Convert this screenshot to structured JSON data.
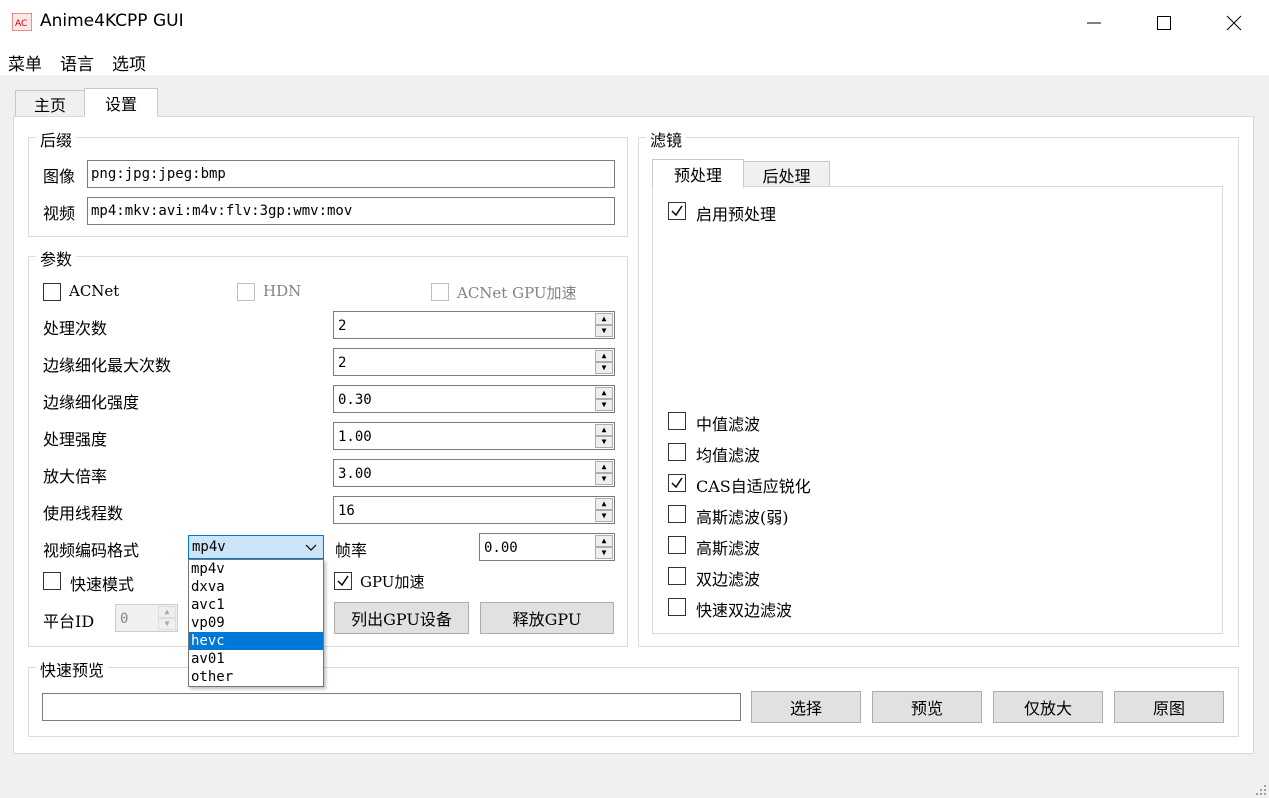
{
  "window": {
    "title": "Anime4KCPP GUI",
    "icon_label": "AC"
  },
  "menu": [
    "菜单",
    "语言",
    "选项"
  ],
  "tabs": [
    {
      "label": "主页"
    },
    {
      "label": "设置"
    }
  ],
  "suffix": {
    "title": "后缀",
    "image_label": "图像",
    "image_value": "png:jpg:jpeg:bmp",
    "video_label": "视频",
    "video_value": "mp4:mkv:avi:m4v:flv:3gp:wmv:mov"
  },
  "params": {
    "title": "参数",
    "acnet": {
      "label": "ACNet",
      "checked": false
    },
    "hdn": {
      "label": "HDN",
      "checked": false
    },
    "acnet_gpu": {
      "label": "ACNet GPU加速",
      "checked": false
    },
    "passes": {
      "label": "处理次数",
      "value": "2"
    },
    "push_grad_passes": {
      "label": "边缘细化最大次数",
      "value": "2"
    },
    "push_grad_strength": {
      "label": "边缘细化强度",
      "value": "0.30"
    },
    "strength": {
      "label": "处理强度",
      "value": "1.00"
    },
    "zoom": {
      "label": "放大倍率",
      "value": "3.00"
    },
    "threads": {
      "label": "使用线程数",
      "value": "16"
    },
    "codec": {
      "label": "视频编码格式",
      "value": "mp4v",
      "options": [
        "mp4v",
        "dxva",
        "avc1",
        "vp09",
        "hevc",
        "av01",
        "other"
      ],
      "highlighted": "hevc"
    },
    "fps": {
      "label": "帧率",
      "value": "0.00"
    },
    "fast_mode": {
      "label": "快速模式",
      "checked": false
    },
    "gpu": {
      "label": "GPU加速",
      "checked": true
    },
    "platform": {
      "label": "平台ID",
      "value": "0"
    },
    "list_gpu_label": "列出GPU设备",
    "release_gpu_label": "释放GPU"
  },
  "filters": {
    "title": "滤镜",
    "tabs": [
      {
        "label": "预处理"
      },
      {
        "label": "后处理"
      }
    ],
    "enable": {
      "label": "启用预处理",
      "checked": true
    },
    "items": [
      {
        "label": "中值滤波",
        "checked": false
      },
      {
        "label": "均值滤波",
        "checked": false
      },
      {
        "label": "CAS自适应锐化",
        "checked": true
      },
      {
        "label": "高斯滤波(弱)",
        "checked": false
      },
      {
        "label": "高斯滤波",
        "checked": false
      },
      {
        "label": "双边滤波",
        "checked": false
      },
      {
        "label": "快速双边滤波",
        "checked": false
      }
    ]
  },
  "preview": {
    "title": "快速预览",
    "path_value": "",
    "select_label": "选择",
    "preview_label": "预览",
    "zoom_only_label": "仅放大",
    "original_label": "原图"
  }
}
